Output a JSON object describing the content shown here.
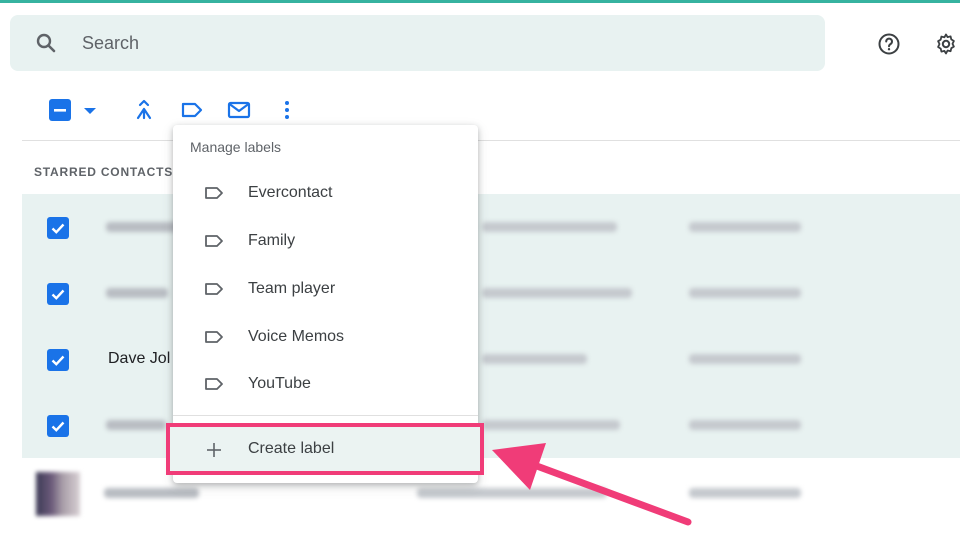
{
  "colors": {
    "accent": "#1a73e8",
    "selected_row": "#e8f2f1",
    "highlight": "#f03c78",
    "top_bar": "#36b3a0"
  },
  "search": {
    "placeholder": "Search",
    "icon": "search-icon"
  },
  "header_icons": [
    "help-icon",
    "settings-icon"
  ],
  "toolbar": {
    "icons": [
      "select-checkbox-icon",
      "dropdown-icon",
      "merge-icon",
      "label-icon",
      "email-icon",
      "more-icon"
    ]
  },
  "list": {
    "section_label": "STARRED CONTACTS",
    "rows": [
      {
        "name": "",
        "checked": true
      },
      {
        "name": "",
        "checked": true
      },
      {
        "name": "Dave Jol",
        "checked": true
      },
      {
        "name": "",
        "checked": true
      },
      {
        "name": "",
        "checked": false
      }
    ]
  },
  "menu": {
    "header": "Manage labels",
    "items": [
      {
        "label": "Evercontact",
        "icon": "label-icon"
      },
      {
        "label": "Family",
        "icon": "label-icon"
      },
      {
        "label": "Team player",
        "icon": "label-icon"
      },
      {
        "label": "Voice Memos",
        "icon": "label-icon"
      },
      {
        "label": "YouTube",
        "icon": "label-icon"
      }
    ],
    "create_label": "Create label"
  }
}
